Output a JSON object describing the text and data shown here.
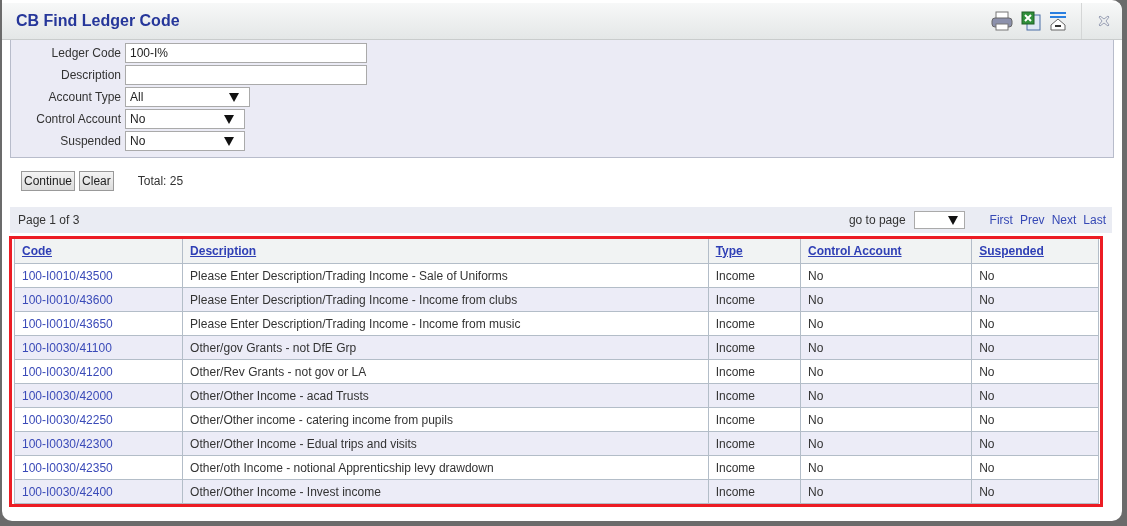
{
  "window": {
    "title": "CB Find Ledger Code"
  },
  "filters": [
    {
      "kind": "text",
      "label": "Ledger Code",
      "value": "100-I%"
    },
    {
      "kind": "text",
      "label": "Description"
    },
    {
      "kind": "select",
      "label": "Account Type",
      "value": "All"
    },
    {
      "kind": "select",
      "label": "Control Account",
      "value": "No"
    },
    {
      "kind": "select",
      "label": "Suspended",
      "value": "No"
    }
  ],
  "buttons": [
    "Continue",
    "Clear"
  ],
  "total": "Total: 25",
  "pager": {
    "page_info": "Page 1 of 3",
    "go_to_label": "go to page",
    "links": [
      "First",
      "Prev",
      "Next",
      "Last"
    ]
  },
  "table": {
    "columns": [
      "Code",
      "Description",
      "Type",
      "Control Account",
      "Suspended"
    ],
    "rows": [
      [
        "100-I0010/43500",
        "Please Enter Description/Trading Income - Sale of Uniforms",
        "Income",
        "No",
        "No"
      ],
      [
        "100-I0010/43600",
        "Please Enter Description/Trading Income - Income from clubs",
        "Income",
        "No",
        "No"
      ],
      [
        "100-I0010/43650",
        "Please Enter Description/Trading Income - Income from music",
        "Income",
        "No",
        "No"
      ],
      [
        "100-I0030/41100",
        "Other/gov Grants - not DfE Grp",
        "Income",
        "No",
        "No"
      ],
      [
        "100-I0030/41200",
        "Other/Rev Grants - not gov or LA",
        "Income",
        "No",
        "No"
      ],
      [
        "100-I0030/42000",
        "Other/Other Income - acad Trusts",
        "Income",
        "No",
        "No"
      ],
      [
        "100-I0030/42250",
        "Other/Other income - catering income from pupils",
        "Income",
        "No",
        "No"
      ],
      [
        "100-I0030/42300",
        "Other/Other Income - Edual trips and visits",
        "Income",
        "No",
        "No"
      ],
      [
        "100-I0030/42350",
        "Other/oth Income - notional Apprenticship levy drawdown",
        "Income",
        "No",
        "No"
      ],
      [
        "100-I0030/42400",
        "Other/Other Income - Invest income",
        "Income",
        "No",
        "No"
      ]
    ]
  }
}
